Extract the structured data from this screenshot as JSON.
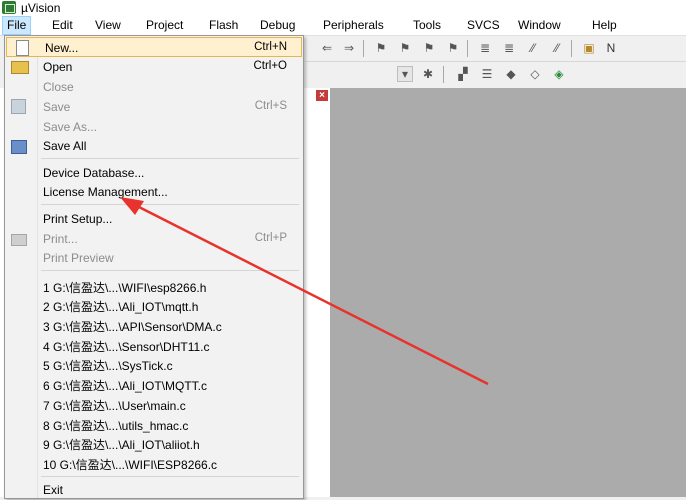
{
  "app": {
    "title": "µVision"
  },
  "menubar": {
    "items": [
      "File",
      "Edit",
      "View",
      "Project",
      "Flash",
      "Debug",
      "Peripherals",
      "Tools",
      "SVCS",
      "Window",
      "Help"
    ],
    "active": "File"
  },
  "file_menu": {
    "items": [
      {
        "label": "New...",
        "shortcut": "Ctrl+N",
        "icon": "new-file-icon",
        "highlighted": true
      },
      {
        "label": "Open",
        "shortcut": "Ctrl+O",
        "icon": "open-folder-icon"
      },
      {
        "label": "Close",
        "disabled": true
      },
      {
        "label": "Save",
        "shortcut": "Ctrl+S",
        "icon": "save-icon",
        "disabled": true
      },
      {
        "label": "Save As...",
        "disabled": true
      },
      {
        "label": "Save All",
        "icon": "save-all-icon"
      },
      {
        "label": "Device Database..."
      },
      {
        "label": "License Management..."
      },
      {
        "label": "Print Setup..."
      },
      {
        "label": "Print...",
        "shortcut": "Ctrl+P",
        "icon": "print-icon",
        "disabled": true
      },
      {
        "label": "Print Preview",
        "disabled": true
      },
      {
        "label": "1 G:\\信盈达\\...\\WIFI\\esp8266.h"
      },
      {
        "label": "2 G:\\信盈达\\...\\Ali_IOT\\mqtt.h"
      },
      {
        "label": "3 G:\\信盈达\\...\\API\\Sensor\\DMA.c"
      },
      {
        "label": "4 G:\\信盈达\\...\\Sensor\\DHT11.c"
      },
      {
        "label": "5 G:\\信盈达\\...\\SysTick.c"
      },
      {
        "label": "6 G:\\信盈达\\...\\Ali_IOT\\MQTT.c"
      },
      {
        "label": "7 G:\\信盈达\\...\\User\\main.c"
      },
      {
        "label": "8 G:\\信盈达\\...\\utils_hmac.c"
      },
      {
        "label": "9 G:\\信盈达\\...\\Ali_IOT\\aliiot.h"
      },
      {
        "label": "10 G:\\信盈达\\...\\WIFI\\ESP8266.c"
      },
      {
        "label": "Exit"
      }
    ]
  },
  "colors": {
    "highlight_bg": "#fff1d0",
    "highlight_border": "#e8b54a",
    "annotation_arrow": "#e8322c",
    "editor_bg": "#ababab"
  },
  "toolbar": {
    "row1_icons": [
      "back-arrow-icon",
      "forward-arrow-icon",
      "bookmark-icon",
      "prev-bookmark-icon",
      "next-bookmark-icon",
      "clear-bookmarks-icon",
      "indent-icon",
      "unindent-icon",
      "comment-icon",
      "uncomment-icon",
      "find-in-files-icon"
    ],
    "row2_icons": [
      "dropdown-icon",
      "configure-icon",
      "manage-components-icon",
      "select-packs-icon",
      "gem-icon",
      "diamond-icon",
      "pack-installer-icon"
    ]
  }
}
